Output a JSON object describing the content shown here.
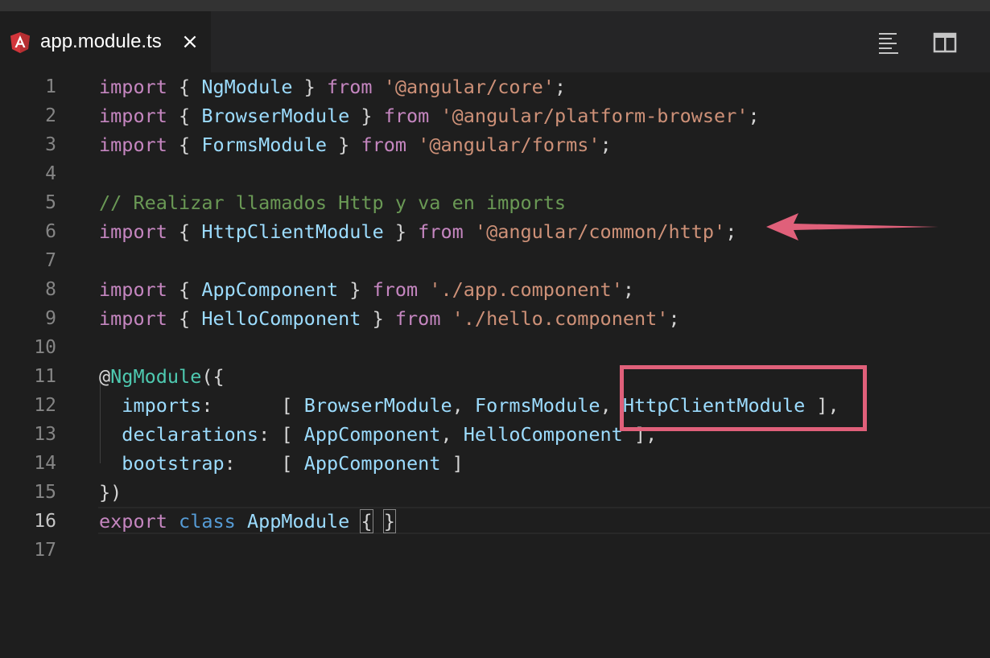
{
  "tab": {
    "title": "app.module.ts",
    "close": "×",
    "icon": "angular-icon"
  },
  "actions": [
    {
      "name": "outline-icon"
    },
    {
      "name": "split-editor-icon"
    }
  ],
  "colors": {
    "keyword": "#c586c0",
    "string": "#ce9178",
    "identifier": "#9cdcfe",
    "comment": "#6a9955",
    "annotation": "#e0607a"
  },
  "code": {
    "lines": [
      {
        "n": "1",
        "tokens": [
          [
            "kw",
            "import"
          ],
          [
            "pun",
            " { "
          ],
          [
            "id",
            "NgModule"
          ],
          [
            "pun",
            " } "
          ],
          [
            "kw",
            "from"
          ],
          [
            "pun",
            " "
          ],
          [
            "str",
            "'@angular/core'"
          ],
          [
            "pun",
            ";"
          ]
        ]
      },
      {
        "n": "2",
        "tokens": [
          [
            "kw",
            "import"
          ],
          [
            "pun",
            " { "
          ],
          [
            "id",
            "BrowserModule"
          ],
          [
            "pun",
            " } "
          ],
          [
            "kw",
            "from"
          ],
          [
            "pun",
            " "
          ],
          [
            "str",
            "'@angular/platform-browser'"
          ],
          [
            "pun",
            ";"
          ]
        ]
      },
      {
        "n": "3",
        "tokens": [
          [
            "kw",
            "import"
          ],
          [
            "pun",
            " { "
          ],
          [
            "id",
            "FormsModule"
          ],
          [
            "pun",
            " } "
          ],
          [
            "kw",
            "from"
          ],
          [
            "pun",
            " "
          ],
          [
            "str",
            "'@angular/forms'"
          ],
          [
            "pun",
            ";"
          ]
        ]
      },
      {
        "n": "4",
        "tokens": []
      },
      {
        "n": "5",
        "tokens": [
          [
            "cm",
            "// Realizar llamados Http y va en imports"
          ]
        ]
      },
      {
        "n": "6",
        "tokens": [
          [
            "kw",
            "import"
          ],
          [
            "pun",
            " { "
          ],
          [
            "id",
            "HttpClientModule"
          ],
          [
            "pun",
            " } "
          ],
          [
            "kw",
            "from"
          ],
          [
            "pun",
            " "
          ],
          [
            "str",
            "'@angular/common/http'"
          ],
          [
            "pun",
            ";"
          ]
        ]
      },
      {
        "n": "7",
        "tokens": []
      },
      {
        "n": "8",
        "tokens": [
          [
            "kw",
            "import"
          ],
          [
            "pun",
            " { "
          ],
          [
            "id",
            "AppComponent"
          ],
          [
            "pun",
            " } "
          ],
          [
            "kw",
            "from"
          ],
          [
            "pun",
            " "
          ],
          [
            "str",
            "'./app.component'"
          ],
          [
            "pun",
            ";"
          ]
        ]
      },
      {
        "n": "9",
        "tokens": [
          [
            "kw",
            "import"
          ],
          [
            "pun",
            " { "
          ],
          [
            "id",
            "HelloComponent"
          ],
          [
            "pun",
            " } "
          ],
          [
            "kw",
            "from"
          ],
          [
            "pun",
            " "
          ],
          [
            "str",
            "'./hello.component'"
          ],
          [
            "pun",
            ";"
          ]
        ]
      },
      {
        "n": "10",
        "tokens": []
      },
      {
        "n": "11",
        "tokens": [
          [
            "pun",
            "@"
          ],
          [
            "dec",
            "NgModule"
          ],
          [
            "pun",
            "({"
          ]
        ]
      },
      {
        "n": "12",
        "tokens": [
          [
            "pun",
            "  "
          ],
          [
            "id",
            "imports"
          ],
          [
            "pun",
            ":      [ "
          ],
          [
            "id",
            "BrowserModule"
          ],
          [
            "pun",
            ", "
          ],
          [
            "id",
            "FormsModule"
          ],
          [
            "pun",
            ", "
          ],
          [
            "id",
            "HttpClientModule"
          ],
          [
            "pun",
            " ],"
          ]
        ]
      },
      {
        "n": "13",
        "tokens": [
          [
            "pun",
            "  "
          ],
          [
            "id",
            "declarations"
          ],
          [
            "pun",
            ": [ "
          ],
          [
            "id",
            "AppComponent"
          ],
          [
            "pun",
            ", "
          ],
          [
            "id",
            "HelloComponent"
          ],
          [
            "pun",
            " ],"
          ]
        ]
      },
      {
        "n": "14",
        "tokens": [
          [
            "pun",
            "  "
          ],
          [
            "id",
            "bootstrap"
          ],
          [
            "pun",
            ":    [ "
          ],
          [
            "id",
            "AppComponent"
          ],
          [
            "pun",
            " ]"
          ]
        ]
      },
      {
        "n": "15",
        "tokens": [
          [
            "pun",
            "})"
          ]
        ]
      },
      {
        "n": "16",
        "tokens": [
          [
            "kw",
            "export"
          ],
          [
            "pun",
            " "
          ],
          [
            "kw2",
            "class"
          ],
          [
            "pun",
            " "
          ],
          [
            "id",
            "AppModule"
          ],
          [
            "pun",
            " "
          ],
          [
            "pun",
            "{"
          ],
          [
            "pun",
            " "
          ],
          [
            "pun",
            "}"
          ]
        ]
      },
      {
        "n": "17",
        "tokens": []
      }
    ],
    "active_line": "16"
  }
}
